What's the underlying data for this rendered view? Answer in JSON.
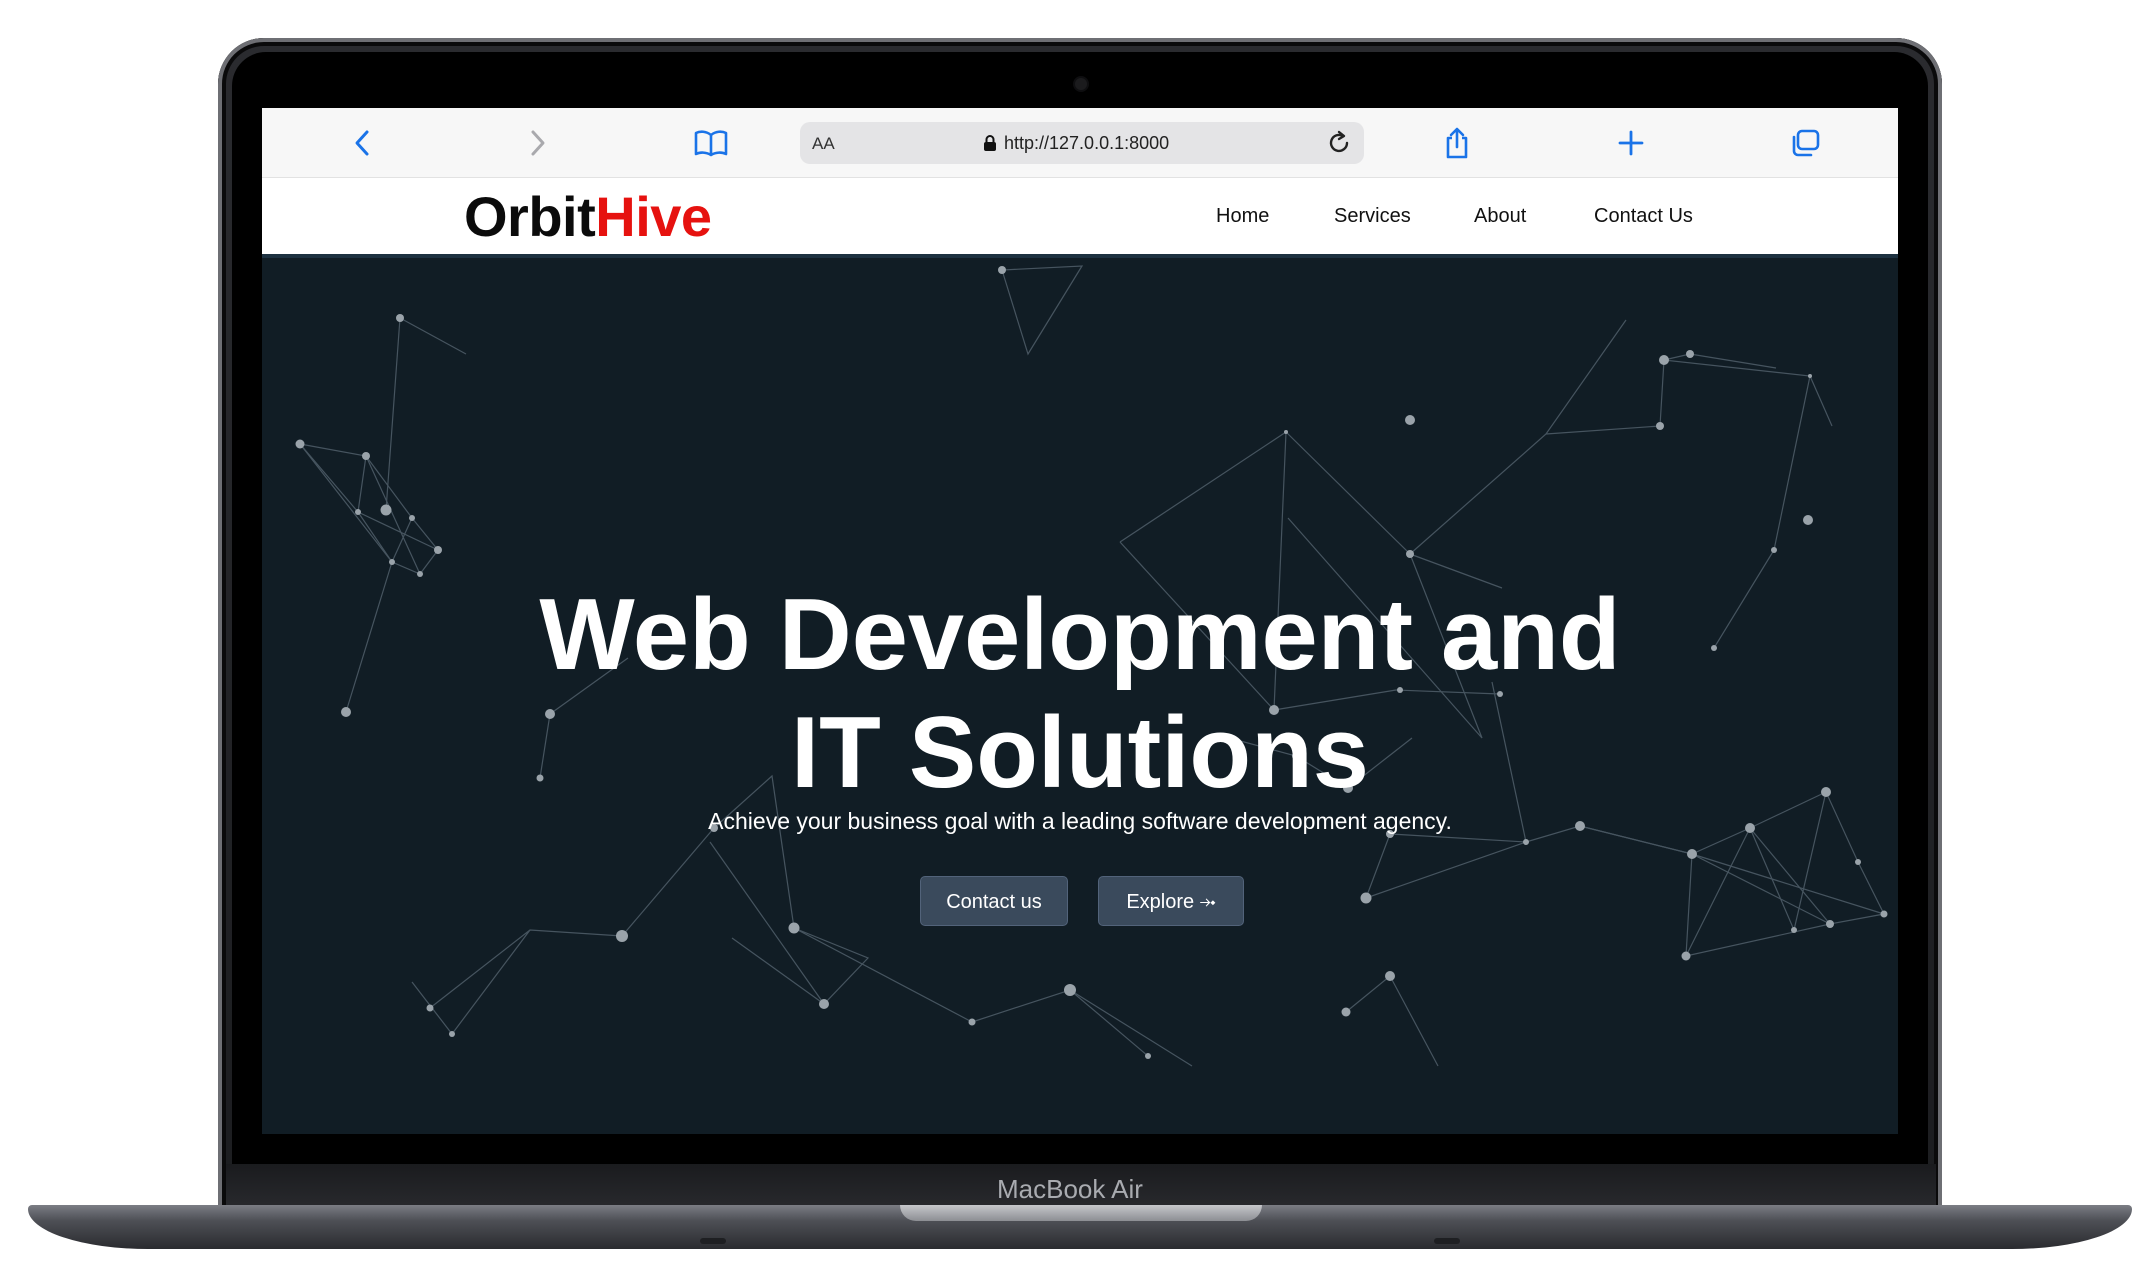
{
  "device": {
    "label": "MacBook Air"
  },
  "browser": {
    "text_size_label": "AA",
    "url": "http://127.0.0.1:8000",
    "icons": {
      "back": "chevron-left-icon",
      "forward": "chevron-right-icon",
      "bookmarks": "book-icon",
      "lock": "lock-icon",
      "reload": "reload-icon",
      "share": "share-icon",
      "new_tab": "plus-icon",
      "tabs": "tabs-icon"
    },
    "accent": "#1a73e8"
  },
  "site": {
    "logo": {
      "part1": "Orbit",
      "part2": "Hive",
      "part1_color": "#0b0b0b",
      "part2_color": "#e6120f"
    },
    "nav": {
      "home": "Home",
      "services": "Services",
      "about": "About",
      "contact": "Contact Us"
    },
    "hero": {
      "title_line1": "Web Development and",
      "title_line2": "IT Solutions",
      "subtitle": "Achieve your business goal with a leading software development agency.",
      "contact_button": "Contact us",
      "explore_button": "Explore ⤞",
      "background": "#111d25",
      "button_color": "#3a4a5c"
    }
  }
}
